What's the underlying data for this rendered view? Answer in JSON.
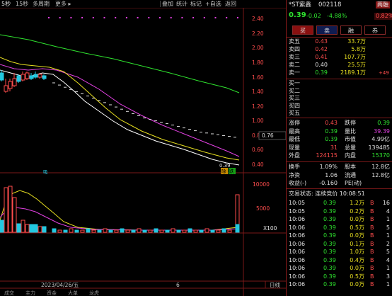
{
  "toolbar": {
    "items": [
      "5秒",
      "15秒",
      "多周期",
      "更多 ▸"
    ],
    "right_items": [
      "叠加",
      "统计",
      "标记",
      "+自选",
      "返回"
    ],
    "active_index": 0
  },
  "chart": {
    "price_axis": [
      "2.40",
      "2.20",
      "2.00",
      "1.80",
      "1.60",
      "1.40",
      "1.20",
      "1.00",
      "0.80",
      "0.60",
      "0.40"
    ],
    "current_price_tag": "0.76",
    "last_price_label": "0.39",
    "badge1": "除",
    "badge2": "跌",
    "marker_left": "吸",
    "volume_axis": [
      "10000",
      "5000",
      "X100"
    ],
    "date_label": "2023/04/26/五",
    "month_label": "6",
    "period_label": "日线",
    "colors": {
      "ma5": "#ffffff",
      "ma10": "#e8e020",
      "ma20": "#e040e0",
      "ma60": "#2fe32f",
      "candle_up": "#ff4d4d",
      "candle_down": "#22c8e0"
    },
    "bottom_tabs": [
      "成交",
      "主力",
      "资金",
      "大单",
      "龙虎"
    ]
  },
  "panel": {
    "title_name": "*ST紫鑫",
    "title_code": "002118",
    "corner_label": "两融",
    "price": "0.39",
    "change": "-0.02",
    "change_pct": "-4.88%",
    "badge_pct": "0.82%",
    "buttons": [
      "买",
      "卖",
      "融",
      "券"
    ],
    "asks": [
      {
        "label": "卖五",
        "price": "0.43",
        "vol": "33.7万"
      },
      {
        "label": "卖四",
        "price": "0.42",
        "vol": "5.8万"
      },
      {
        "label": "卖三",
        "price": "0.41",
        "vol": "107.7万"
      },
      {
        "label": "卖二",
        "price": "0.40",
        "vol": "25.5万"
      },
      {
        "label": "卖一",
        "price": "0.39",
        "vol": "2189.1万",
        "extra": "+49"
      }
    ],
    "bids": [
      "买一",
      "买二",
      "买三",
      "买四",
      "买五"
    ],
    "stats_left": [
      {
        "label": "涨停",
        "value": "0.43"
      },
      {
        "label": "最高",
        "value": "0.39"
      },
      {
        "label": "最低",
        "value": "0.39"
      },
      {
        "label": "现量",
        "value": "31"
      },
      {
        "label": "外盘",
        "value": "124115"
      }
    ],
    "stats_right": [
      {
        "label": "跌停",
        "value": "0.39"
      },
      {
        "label": "量比",
        "value": "39.39"
      },
      {
        "label": "市值",
        "value": "4.99亿"
      },
      {
        "label": "总量",
        "value": "139485"
      },
      {
        "label": "内盘",
        "value": "15370"
      }
    ],
    "stats2_left": [
      {
        "label": "换手",
        "value": "1.09%"
      },
      {
        "label": "净资",
        "value": "1.06"
      },
      {
        "label": "收益(-)",
        "value": "-0.160"
      }
    ],
    "stats2_right": [
      {
        "label": "股本",
        "value": "12.8亿"
      },
      {
        "label": "流通",
        "value": "12.8亿"
      },
      {
        "label": "PE(动)",
        "value": ""
      }
    ],
    "trade_status": "交易状态: 连续竞价 10:08:51",
    "ticks": [
      {
        "time": "10:05",
        "price": "0.39",
        "vol": "1.2万",
        "dir": "B",
        "n": "16"
      },
      {
        "time": "10:05",
        "price": "0.39",
        "vol": "0.2万",
        "dir": "B",
        "n": "4"
      },
      {
        "time": "10:06",
        "price": "0.39",
        "vol": "0.0万",
        "dir": "B",
        "n": "1"
      },
      {
        "time": "10:06",
        "price": "0.39",
        "vol": "0.5万",
        "dir": "B",
        "n": "5"
      },
      {
        "time": "10:06",
        "price": "0.39",
        "vol": "0.0万",
        "dir": "B",
        "n": "1"
      },
      {
        "time": "10:06",
        "price": "0.39",
        "vol": "0.1万",
        "dir": "B",
        "n": "2"
      },
      {
        "time": "10:06",
        "price": "0.39",
        "vol": "1.0万",
        "dir": "B",
        "n": "5"
      },
      {
        "time": "10:06",
        "price": "0.39",
        "vol": "0.4万",
        "dir": "B",
        "n": "4"
      },
      {
        "time": "10:06",
        "price": "0.39",
        "vol": "0.0万",
        "dir": "B",
        "n": "1"
      },
      {
        "time": "10:06",
        "price": "0.39",
        "vol": "0.5万",
        "dir": "B",
        "n": "3"
      },
      {
        "time": "10:06",
        "price": "0.39",
        "vol": "0.0万",
        "dir": "B",
        "n": "1"
      }
    ]
  }
}
